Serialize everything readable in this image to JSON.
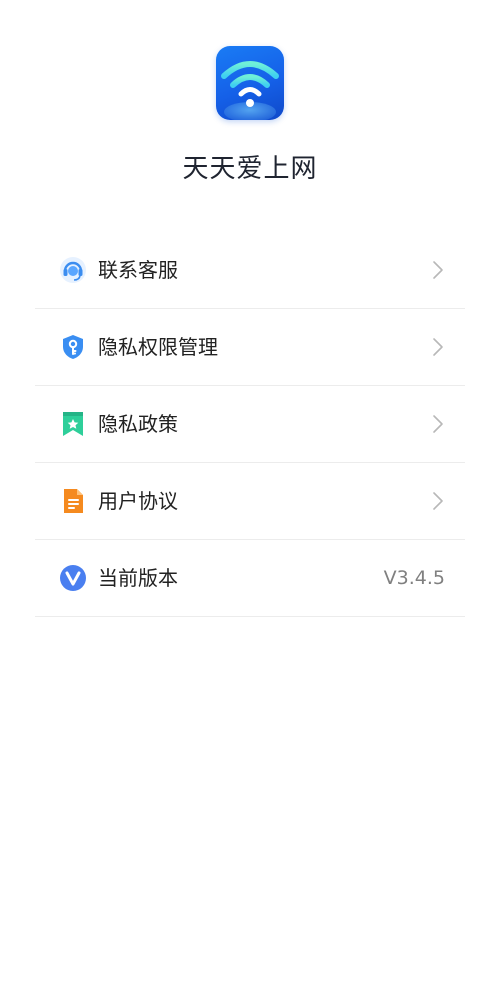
{
  "app": {
    "name": "天天爱上网",
    "logo_icon": "wifi-icon",
    "logo_color": "#1a6cf0"
  },
  "menu": {
    "items": [
      {
        "label": "联系客服",
        "icon": "headset-icon",
        "color": "#3b8df0"
      },
      {
        "label": "隐私权限管理",
        "icon": "shield-key-icon",
        "color": "#3a8ef2"
      },
      {
        "label": "隐私政策",
        "icon": "bookmark-star-icon",
        "color": "#2ecf9a"
      },
      {
        "label": "用户协议",
        "icon": "document-icon",
        "color": "#f58a1f"
      },
      {
        "label": "当前版本",
        "icon": "version-v-icon",
        "color": "#4a7ff0",
        "value": "V3.4.5"
      }
    ]
  }
}
